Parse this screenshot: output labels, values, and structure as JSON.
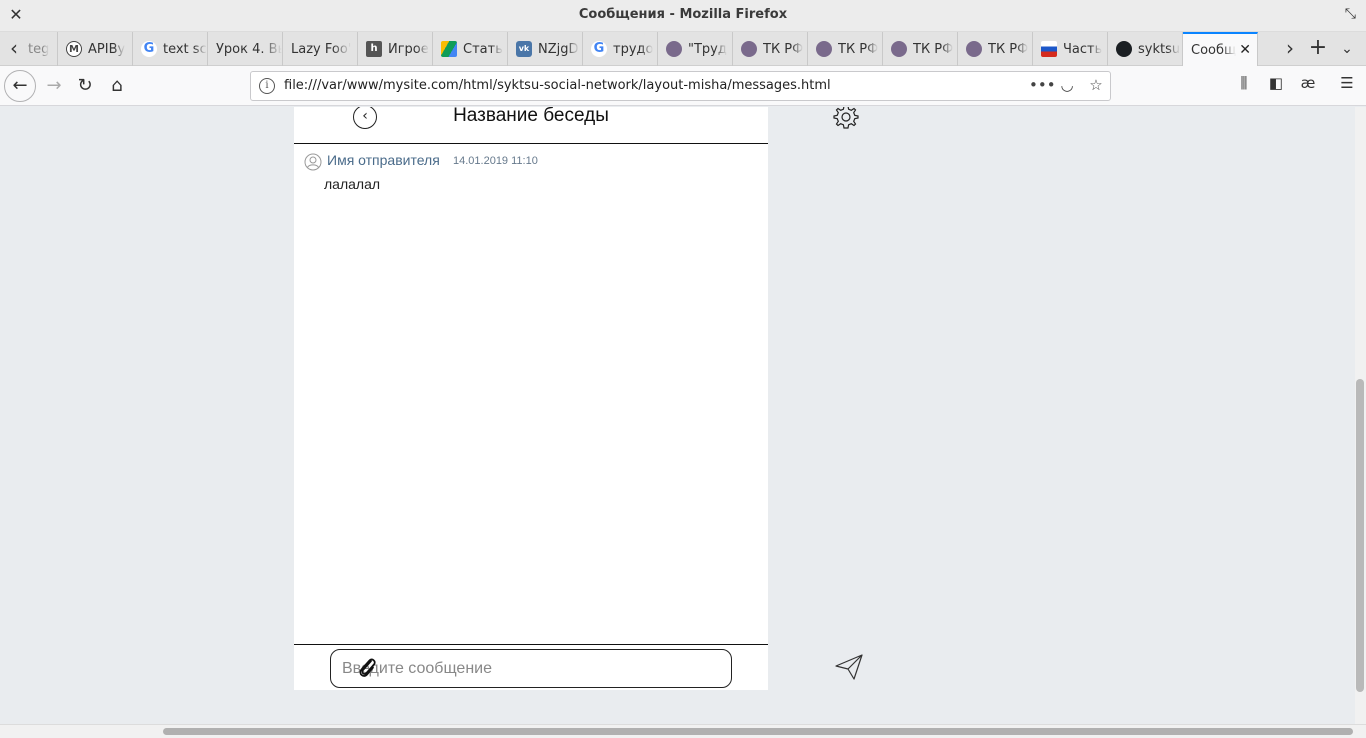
{
  "window": {
    "title": "Сообщения - Mozilla Firefox"
  },
  "tabs": [
    {
      "label": "teg",
      "icon": "generic-favicon-icon"
    },
    {
      "label": "APIBy",
      "icon": "m-favicon-icon"
    },
    {
      "label": "text sc",
      "icon": "google-favicon-icon"
    },
    {
      "label": "Урок 4. Вы",
      "icon": "none"
    },
    {
      "label": "Lazy Foo'",
      "icon": "none"
    },
    {
      "label": "Игрое",
      "icon": "h-favicon-icon"
    },
    {
      "label": "Стать",
      "icon": "drive-favicon-icon"
    },
    {
      "label": "NZjgD",
      "icon": "vk-favicon-icon"
    },
    {
      "label": "трудо",
      "icon": "google-favicon-icon"
    },
    {
      "label": "\"Труд",
      "icon": "avatar-favicon-icon"
    },
    {
      "label": "ТК РФ",
      "icon": "avatar-favicon-icon"
    },
    {
      "label": "ТК РФ",
      "icon": "avatar-favicon-icon"
    },
    {
      "label": "ТК РФ",
      "icon": "avatar-favicon-icon"
    },
    {
      "label": "ТК РФ",
      "icon": "avatar-favicon-icon"
    },
    {
      "label": "Часть",
      "icon": "flag-favicon-icon"
    },
    {
      "label": "syktsu",
      "icon": "github-favicon-icon"
    },
    {
      "label": "Сообщ",
      "icon": "none",
      "active": true
    }
  ],
  "navbar": {
    "url": "file:///var/www/mysite.com/html/syktsu-social-network/layout-misha/messages.html",
    "page_actions_label": "•••"
  },
  "chat": {
    "title": "Название беседы",
    "messages": [
      {
        "sender": "Имя отправителя",
        "time": "14.01.2019 11:10",
        "text": "лалалал"
      }
    ],
    "input_placeholder": "Введите сообщение"
  },
  "colors": {
    "page_background": "#e9ecef",
    "sender_name": "#4a6b8a",
    "active_tab_accent": "#0a84ff"
  }
}
